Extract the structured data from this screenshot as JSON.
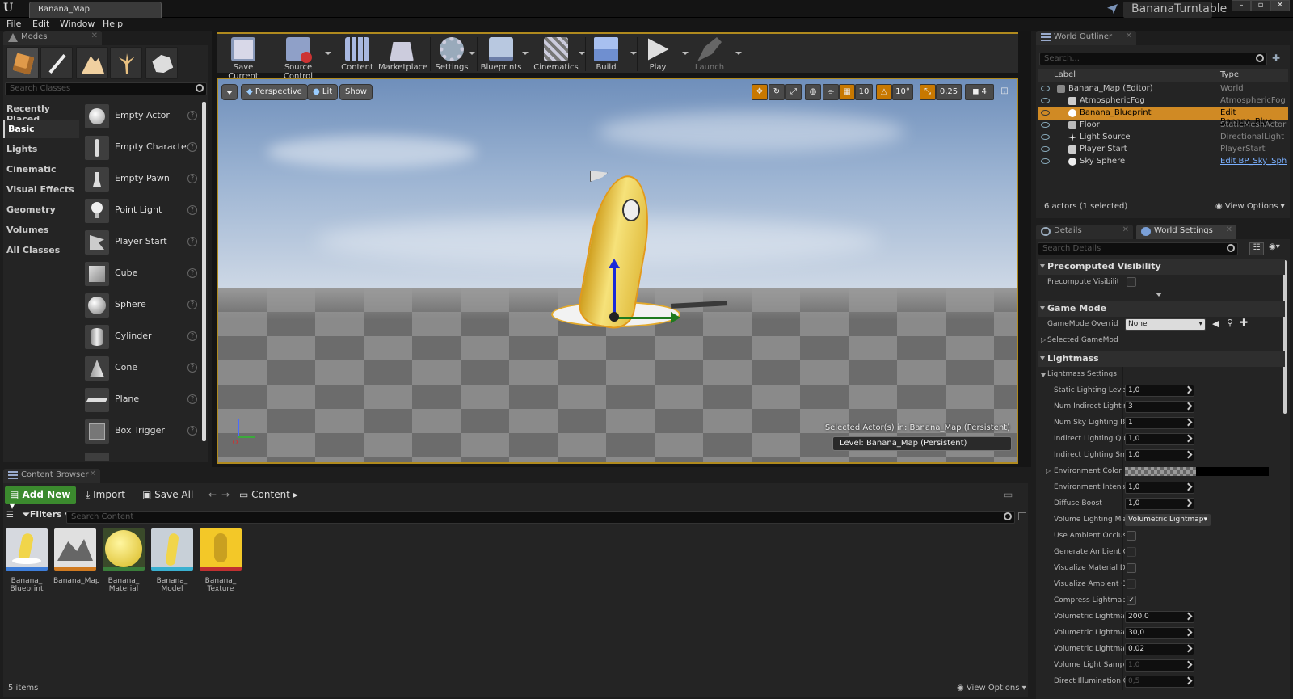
{
  "window": {
    "doc_tab": "Banana_Map",
    "project": "BananaTurntable",
    "minimize": "–",
    "restore": "▫",
    "close": "✕"
  },
  "menu": [
    "File",
    "Edit",
    "Window",
    "Help"
  ],
  "modes": {
    "tab": "Modes",
    "search_placeholder": "Search Classes",
    "categories": [
      "Recently Placed",
      "Basic",
      "Lights",
      "Cinematic",
      "Visual Effects",
      "Geometry",
      "Volumes",
      "All Classes"
    ],
    "items": [
      "Empty Actor",
      "Empty Character",
      "Empty Pawn",
      "Point Light",
      "Player Start",
      "Cube",
      "Sphere",
      "Cylinder",
      "Cone",
      "Plane",
      "Box Trigger"
    ]
  },
  "toolbar": {
    "buttons": [
      "Save Current",
      "Source Control",
      "Content",
      "Marketplace",
      "Settings",
      "Blueprints",
      "Cinematics",
      "Build",
      "Play",
      "Launch"
    ]
  },
  "viewport": {
    "perspective": "Perspective",
    "lit": "Lit",
    "show": "Show",
    "grid_snap": "10",
    "rot_snap": "10°",
    "scale_snap": "0,25",
    "cam_speed": "4",
    "selected_text": "Selected Actor(s) in:  Banana_Map (Persistent)",
    "level_text": "Level:  Banana_Map (Persistent)"
  },
  "content_browser": {
    "tab": "Content Browser",
    "add_new": "Add New",
    "import": "Import",
    "save_all": "Save All",
    "path": "Content",
    "filters": "Filters",
    "search_placeholder": "Search Content",
    "assets": [
      {
        "line1": "Banana_",
        "line2": "Blueprint"
      },
      {
        "line1": "Banana_Map",
        "line2": ""
      },
      {
        "line1": "Banana_",
        "line2": "Material"
      },
      {
        "line1": "Banana_",
        "line2": "Model"
      },
      {
        "line1": "Banana_",
        "line2": "Texture"
      }
    ],
    "item_count": "5 items",
    "view_options": "View Options"
  },
  "outliner": {
    "tab": "World Outliner",
    "search_placeholder": "Search...",
    "col_label": "Label",
    "col_type": "Type",
    "rows": [
      {
        "label": "Banana_Map (Editor)",
        "type": "World"
      },
      {
        "label": "AtmosphericFog",
        "type": "AtmosphericFog"
      },
      {
        "label": "Banana_Blueprint",
        "type": "Edit Banana_Blue"
      },
      {
        "label": "Floor",
        "type": "StaticMeshActor"
      },
      {
        "label": "Light Source",
        "type": "DirectionalLight"
      },
      {
        "label": "Player Start",
        "type": "PlayerStart"
      },
      {
        "label": "Sky Sphere",
        "type": "Edit BP_Sky_Sph"
      }
    ],
    "status": "6 actors (1 selected)",
    "view_options": "View Options"
  },
  "details": {
    "tab_details": "Details",
    "tab_world": "World Settings",
    "search_placeholder": "Search Details",
    "sec_precomputed": "Precomputed Visibility",
    "precompute_label": "Precompute Visibility",
    "sec_gamemode": "Game Mode",
    "gamemode_label": "GameMode Override",
    "gamemode_value": "None",
    "selected_gamemode": "Selected GameMode",
    "sec_lightmass": "Lightmass",
    "lightmass_settings": "Lightmass Settings",
    "rows": [
      {
        "label": "Static Lighting Leve",
        "value": "1,0"
      },
      {
        "label": "Num Indirect Lightin",
        "value": "3"
      },
      {
        "label": "Num Sky Lighting B",
        "value": "1"
      },
      {
        "label": "Indirect Lighting Qu",
        "value": "1,0"
      },
      {
        "label": "Indirect Lighting Sm",
        "value": "1,0"
      }
    ],
    "env_color": "Environment Color",
    "rows2": [
      {
        "label": "Environment Intensi",
        "value": "1,0"
      },
      {
        "label": "Diffuse Boost",
        "value": "1,0"
      }
    ],
    "vol_light_method": "Volume Lighting Me",
    "vol_light_value": "Volumetric Lightmap",
    "checks": [
      {
        "label": "Use Ambient Occlus",
        "checked": ""
      },
      {
        "label": "Generate Ambient O",
        "checked": ""
      },
      {
        "label": "Visualize Material D",
        "checked": ""
      },
      {
        "label": "Visualize Ambient O",
        "checked": ""
      },
      {
        "label": "Compress Lightmap",
        "checked": "✓"
      }
    ],
    "rows3": [
      {
        "label": "Volumetric Lightma",
        "value": "200,0"
      },
      {
        "label": "Volumetric Lightma",
        "value": "30,0"
      },
      {
        "label": "Volumetric Lightma",
        "value": "0,02"
      },
      {
        "label": "Volume Light Sampl",
        "value": "1,0"
      },
      {
        "label": "Direct Illumination O",
        "value": "0,5"
      }
    ]
  }
}
